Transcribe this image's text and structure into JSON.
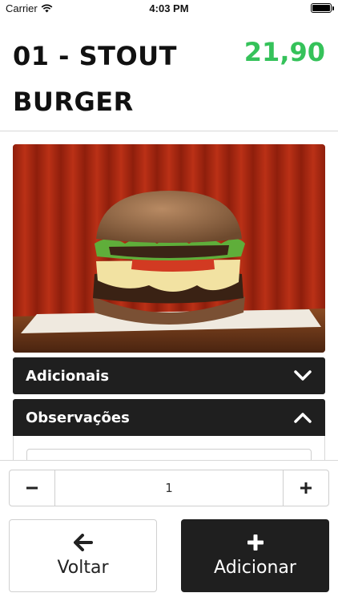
{
  "status_bar": {
    "carrier": "Carrier",
    "time": "4:03 PM",
    "wifi_icon": "wifi-icon",
    "battery_icon": "battery-icon"
  },
  "product": {
    "title": "01 - STOUT BURGER",
    "price": "21,90",
    "price_color": "#35c25a",
    "image_subject": "burger-photo"
  },
  "sections": {
    "adicionais": {
      "label": "Adicionais",
      "icon": "chevron-down-icon"
    },
    "observacoes": {
      "label": "Observações",
      "icon": "chevron-up-icon"
    }
  },
  "quantity": {
    "value": "1",
    "minus_icon": "minus-icon",
    "plus_icon": "plus-icon"
  },
  "actions": {
    "back_label": "Voltar",
    "back_icon": "arrow-left-icon",
    "add_label": "Adicionar",
    "add_icon": "plus-icon"
  },
  "colors": {
    "dark": "#1f1f1f",
    "price_green": "#35c25a",
    "border": "#d8d8d8"
  }
}
